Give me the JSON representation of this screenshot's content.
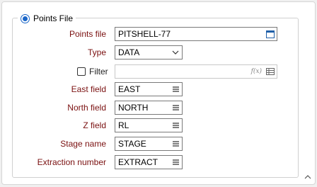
{
  "group": {
    "title": "Points File",
    "selected": true
  },
  "fields": {
    "points_file": {
      "label": "Points file",
      "value": "PITSHELL-77"
    },
    "type": {
      "label": "Type",
      "value": "DATA"
    },
    "filter": {
      "label": "Filter",
      "value": "",
      "checked": false,
      "fx": "f(x)"
    },
    "east": {
      "label": "East field",
      "value": "EAST"
    },
    "north": {
      "label": "North field",
      "value": "NORTH"
    },
    "z": {
      "label": "Z field",
      "value": "RL"
    },
    "stage": {
      "label": "Stage name",
      "value": "STAGE"
    },
    "extraction": {
      "label": "Extraction number",
      "value": "EXTRACT"
    }
  },
  "colors": {
    "required_label": "#7a1010",
    "accent": "#1a66c8"
  },
  "icons": {
    "browse": "window-icon",
    "dropdown": "chevron-down-icon",
    "list": "list-icon",
    "collapse": "chevron-up-icon"
  }
}
